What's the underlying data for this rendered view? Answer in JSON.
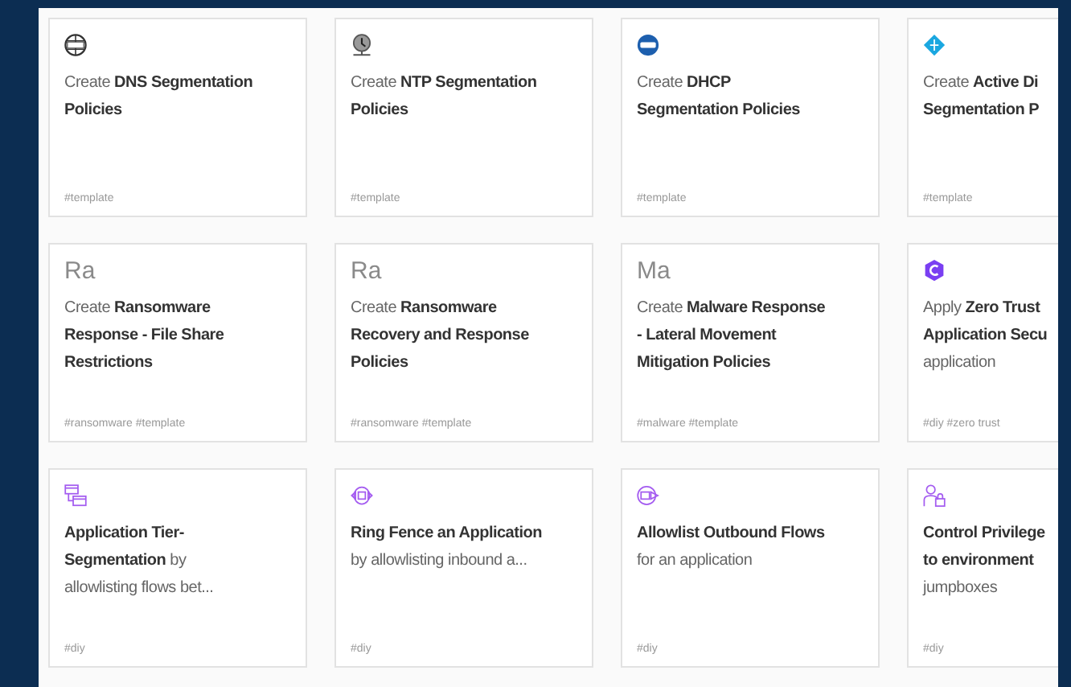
{
  "cards": [
    {
      "kind": "icon",
      "lines": [
        "Create **DNS Segmentation**",
        "**Policies**"
      ],
      "tags": "#template"
    },
    {
      "kind": "icon",
      "lines": [
        "Create **NTP Segmentation**",
        "**Policies**"
      ],
      "tags": "#template"
    },
    {
      "kind": "icon",
      "lines": [
        "Create **DHCP**",
        "**Segmentation Policies**"
      ],
      "tags": "#template"
    },
    {
      "kind": "icon",
      "lines": [
        "Create **Active Di**",
        "**Segmentation P**"
      ],
      "tags": "#template"
    },
    {
      "kind": "monogram",
      "monogram": "Ra",
      "lines": [
        "Create **Ransomware**",
        "**Response - File Share**",
        "**Restrictions**"
      ],
      "tags": "#ransomware #template"
    },
    {
      "kind": "monogram",
      "monogram": "Ra",
      "lines": [
        "Create **Ransomware**",
        "**Recovery and Response**",
        "**Policies**"
      ],
      "tags": "#ransomware #template"
    },
    {
      "kind": "monogram",
      "monogram": "Ma",
      "lines": [
        "Create **Malware Response**",
        "**- Lateral Movement**",
        "**Mitigation Policies**"
      ],
      "tags": "#malware #template"
    },
    {
      "kind": "icon",
      "lines": [
        "Apply **Zero Trust**",
        "**Application Secu**",
        "application"
      ],
      "tags": "#diy #zero trust"
    },
    {
      "kind": "icon",
      "lines": [
        "**Application Tier-**",
        "**Segmentation** by",
        "allowlisting flows bet..."
      ],
      "tags": "#diy"
    },
    {
      "kind": "icon",
      "lines": [
        "**Ring Fence an Application**",
        "by allowlisting inbound a..."
      ],
      "tags": "#diy"
    },
    {
      "kind": "icon",
      "lines": [
        "**Allowlist Outbound Flows**",
        "for an application"
      ],
      "tags": "#diy"
    },
    {
      "kind": "icon",
      "lines": [
        "**Control Privilege**",
        "**to environment**",
        "jumpboxes"
      ],
      "tags": "#diy"
    }
  ]
}
